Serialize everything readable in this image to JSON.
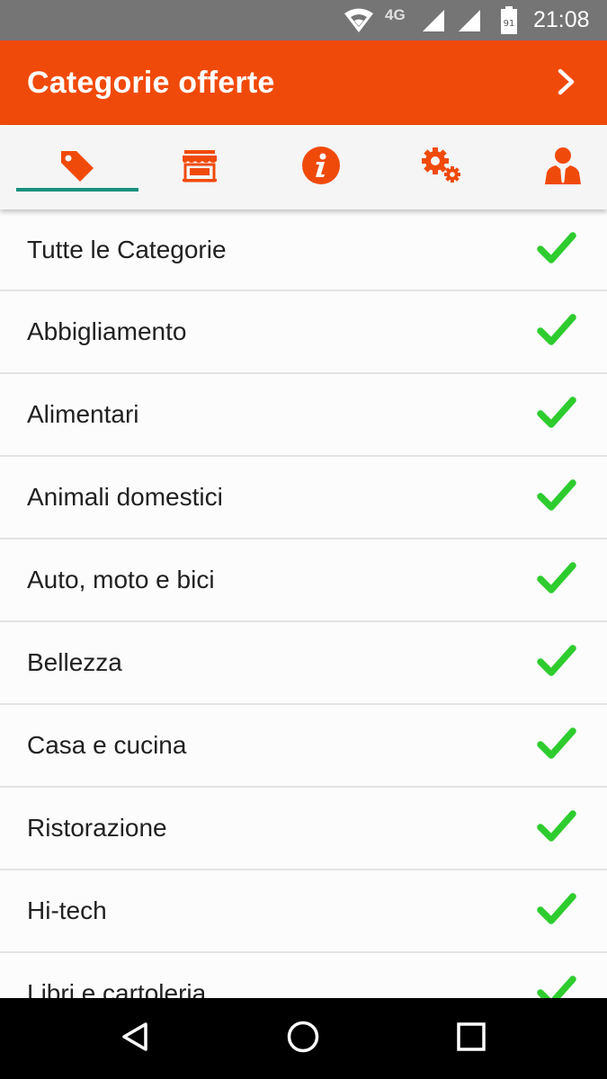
{
  "status_bar": {
    "network": "4G",
    "battery": "91",
    "time": "21:08",
    "icons": [
      "wifi-icon",
      "signal-icon",
      "signal-icon",
      "battery-icon"
    ]
  },
  "app_bar": {
    "title": "Categorie offerte",
    "next_icon": "chevron-right-icon"
  },
  "tabs": [
    {
      "icon": "tag-icon",
      "selected": true
    },
    {
      "icon": "store-icon",
      "selected": false
    },
    {
      "icon": "info-icon",
      "selected": false
    },
    {
      "icon": "gears-icon",
      "selected": false
    },
    {
      "icon": "person-icon",
      "selected": false
    }
  ],
  "categories": [
    {
      "label": "Tutte le Categorie",
      "checked": true
    },
    {
      "label": "Abbigliamento",
      "checked": true
    },
    {
      "label": "Alimentari",
      "checked": true
    },
    {
      "label": "Animali domestici",
      "checked": true
    },
    {
      "label": "Auto, moto e bici",
      "checked": true
    },
    {
      "label": "Bellezza",
      "checked": true
    },
    {
      "label": "Casa e cucina",
      "checked": true
    },
    {
      "label": "Ristorazione",
      "checked": true
    },
    {
      "label": "Hi-tech",
      "checked": true
    },
    {
      "label": "Libri e cartoleria",
      "checked": true
    }
  ],
  "nav_bar": [
    "back-icon",
    "home-icon",
    "recents-icon"
  ],
  "colors": {
    "accent": "#f04a0a",
    "tab_indicator": "#16907f",
    "check": "#2ecc2e",
    "status_bar": "#757575"
  }
}
